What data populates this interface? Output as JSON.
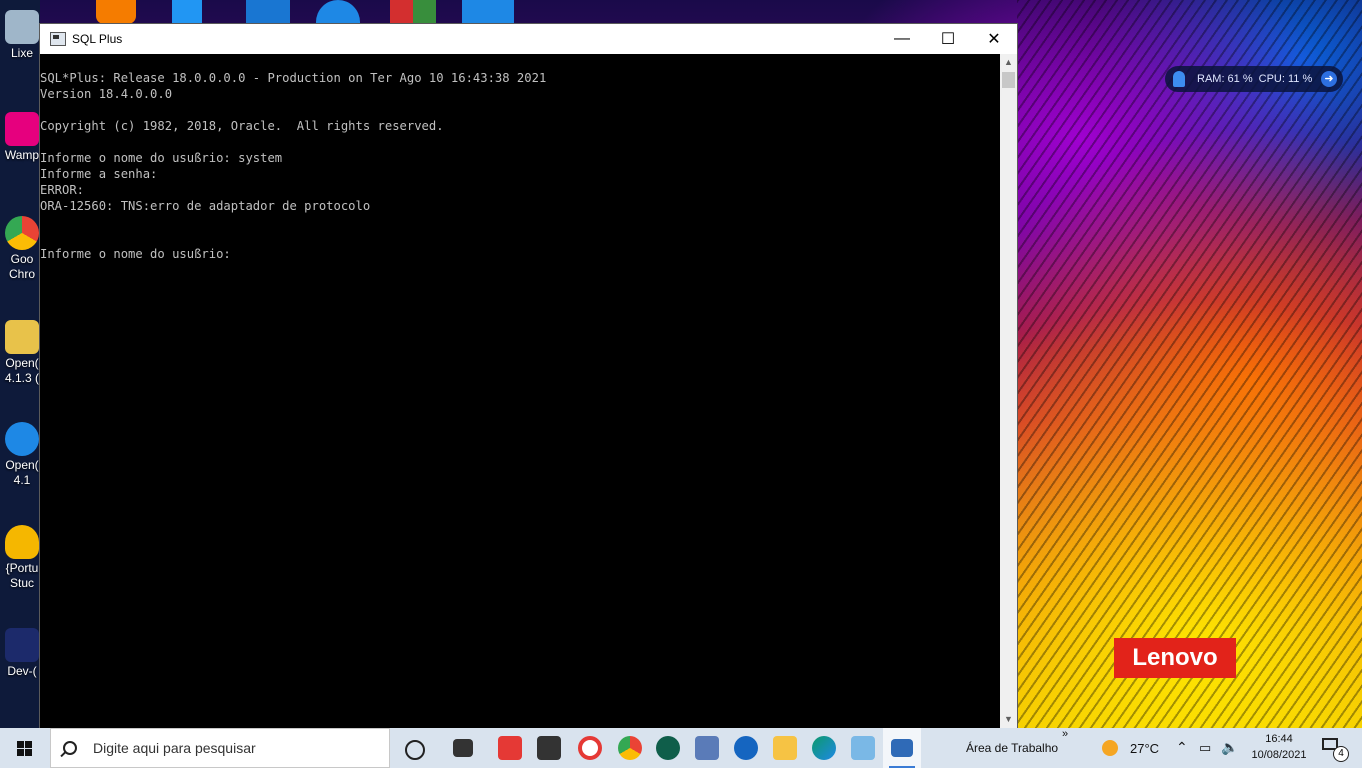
{
  "window": {
    "title": "SQL Plus",
    "minimize_label": "—",
    "maximize_label": "☐",
    "close_label": "✕"
  },
  "console": {
    "lines": [
      "SQL*Plus: Release 18.0.0.0.0 - Production on Ter Ago 10 16:43:38 2021",
      "Version 18.4.0.0.0",
      "",
      "Copyright (c) 1982, 2018, Oracle.  All rights reserved.",
      "",
      "Informe o nome do usußrio: system",
      "Informe a senha:",
      "ERROR:",
      "ORA-12560: TNS:erro de adaptador de protocolo",
      "",
      "",
      "Informe o nome do usußrio:"
    ]
  },
  "desktop_icons": [
    {
      "label": "Lixe",
      "color": "#9fb6c9"
    },
    {
      "label": "Wamp",
      "color": "#e6007e"
    },
    {
      "label": "Goo Chro",
      "color": "#34a853"
    },
    {
      "label": "Open( 4.1.3 (",
      "color": "#e8c24a"
    },
    {
      "label": "Open( 4.1",
      "color": "#1e88e5"
    },
    {
      "label": "{Portu Stuc",
      "color": "#f5b700"
    },
    {
      "label": "Dev-(",
      "color": "#1c2a6b"
    }
  ],
  "sysmon": {
    "ram_label": "RAM: 61 %",
    "cpu_label": "CPU: 11 %"
  },
  "wallpaper_brand": "Lenovo",
  "taskbar": {
    "search_placeholder": "Digite aqui para pesquisar",
    "desktop_label": "Área de Trabalho",
    "desktop_chevron": "»",
    "temperature": "27°C",
    "time": "16:44",
    "date": "10/08/2021",
    "notification_count": "4",
    "pinned_icons": [
      "task-view-icon",
      "widgets-icon",
      "app-red-icon",
      "store-icon",
      "opera-icon",
      "chrome-icon",
      "upwork-icon",
      "box-icon",
      "cclean-icon",
      "file-explorer-icon",
      "edge-icon",
      "notes-icon",
      "sqlplus-icon"
    ]
  },
  "colors": {
    "console_text": "#c0c0c0",
    "console_bg": "#000000",
    "taskbar_bg": "#d9e3ee",
    "lenovo_red": "#e2231a"
  }
}
